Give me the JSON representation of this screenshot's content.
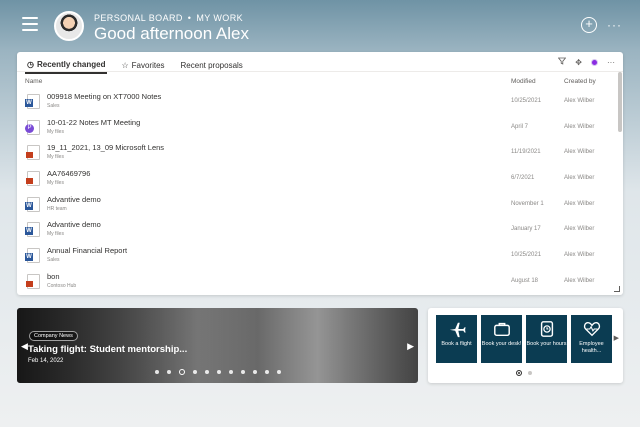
{
  "header": {
    "breadcrumb_1": "PERSONAL BOARD",
    "breadcrumb_2": "MY WORK",
    "greeting": "Good afternoon Alex",
    "add": "+",
    "more": "···"
  },
  "files": {
    "tabs": [
      {
        "label": "Recently changed",
        "icon": "clock-icon"
      },
      {
        "label": "Favorites",
        "icon": "star-icon"
      },
      {
        "label": "Recent proposals"
      }
    ],
    "columns": {
      "name": "Name",
      "modified": "Modified",
      "created_by": "Created by"
    },
    "rows": [
      {
        "name": "009918 Meeting on XT7000 Notes",
        "location": "Sales",
        "modified": "10/25/2021",
        "created_by": "Alex Wilber",
        "type": "word"
      },
      {
        "name": "10-01-22 Notes MT Meeting",
        "location": "My files",
        "modified": "April 7",
        "created_by": "Alex Wilber",
        "type": "loop"
      },
      {
        "name": "19_11_2021, 13_09 Microsoft Lens",
        "location": "My files",
        "modified": "11/19/2021",
        "created_by": "Alex Wilber",
        "type": "image"
      },
      {
        "name": "AA76469796",
        "location": "My files",
        "modified": "6/7/2021",
        "created_by": "Alex Wilber",
        "type": "image"
      },
      {
        "name": "Advantive demo",
        "location": "HR team",
        "modified": "November 1",
        "created_by": "Alex Wilber",
        "type": "word"
      },
      {
        "name": "Advantive demo",
        "location": "My files",
        "modified": "January 17",
        "created_by": "Alex Wilber",
        "type": "word"
      },
      {
        "name": "Annual Financial Report",
        "location": "Sales",
        "modified": "10/25/2021",
        "created_by": "Alex Wilber",
        "type": "word"
      },
      {
        "name": "bon",
        "location": "Contoso Hub",
        "modified": "August 18",
        "created_by": "Alex Wilber",
        "type": "image"
      }
    ]
  },
  "news": {
    "badge": "Company News",
    "title": "Taking flight: Student mentorship...",
    "date": "Feb 14, 2022",
    "dot_count": 11,
    "active_dot": 2
  },
  "quick_links": {
    "tiles": [
      {
        "label": "Book a flight",
        "icon": "airplane-icon"
      },
      {
        "label": "Book your desk!",
        "icon": "briefcase-icon"
      },
      {
        "label": "Book your hours",
        "icon": "clock-tile-icon"
      },
      {
        "label": "Employee health...",
        "icon": "heart-icon"
      }
    ],
    "active_page": 1,
    "page_count": 2
  },
  "colors": {
    "tile": "#0b3c52",
    "word": "#2b579a",
    "loop": "#7a4bd6",
    "image": "#c43e1c"
  }
}
